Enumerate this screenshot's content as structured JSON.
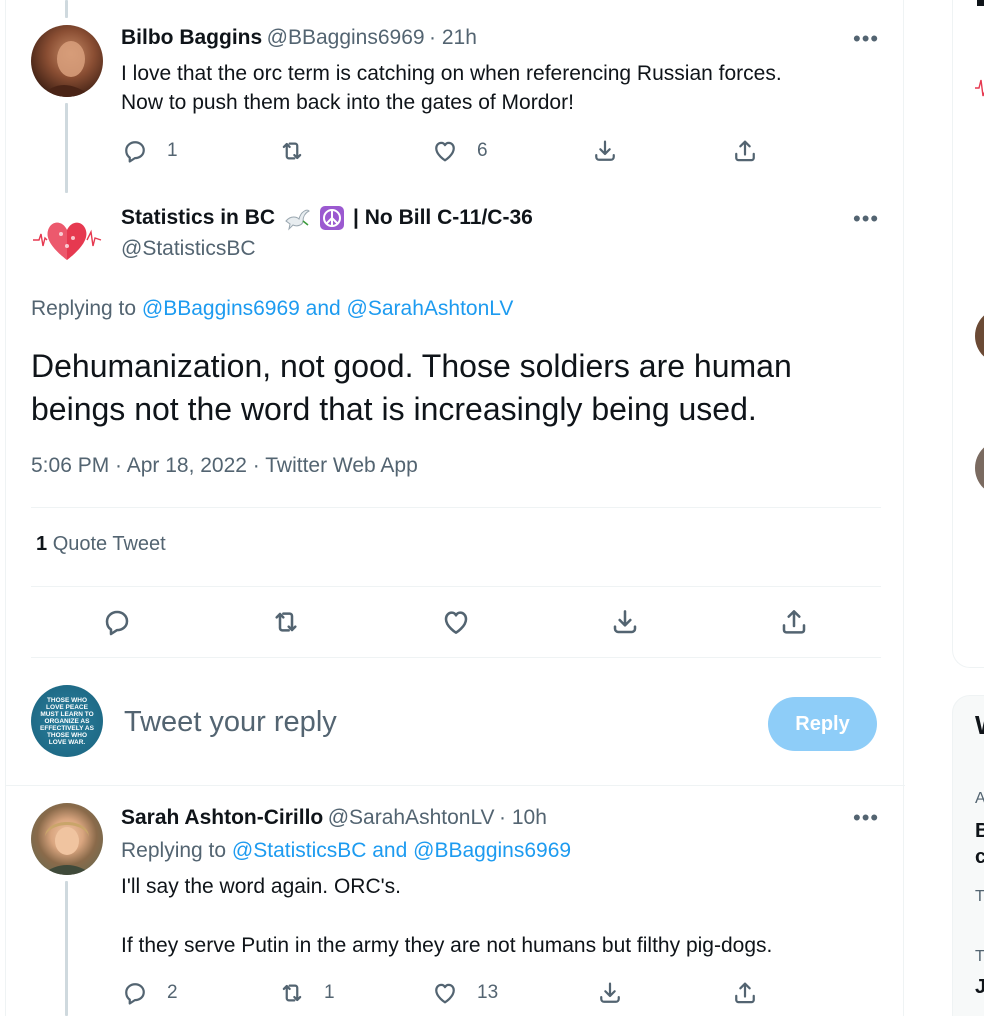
{
  "tweet1": {
    "name": "Bilbo Baggins",
    "handle": "@BBaggins6969",
    "time": "· 21h",
    "text_line1": "I love that the orc term is catching on when referencing Russian forces.",
    "text_line2": "Now to push them back into the gates of Mordor!",
    "reply_count": "1",
    "retweet_count": "",
    "like_count": "6"
  },
  "main_tweet": {
    "name_part1": "Statistics in BC",
    "name_part2": "| No Bill C-11/C-36",
    "handle": "@StatisticsBC",
    "replying_prefix": "Replying to",
    "replying_users": "@BBaggins6969 and @SarahAshtonLV",
    "text_line1": "Dehumanization, not good. Those soldiers are human",
    "text_line2": "beings not the word that is increasingly being used.",
    "meta": "5:06 PM · Apr 18, 2022 · Twitter Web App",
    "quote_count": "1",
    "quote_label": "Quote Tweet"
  },
  "composer": {
    "placeholder": "Tweet your reply",
    "reply_button": "Reply",
    "avatar_text": "THOSE WHO LOVE PEACE MUST LEARN TO ORGANIZE AS EFFECTIVELY AS THOSE WHO LOVE WAR."
  },
  "tweet3": {
    "name": "Sarah Ashton-Cirillo",
    "handle": "@SarahAshtonLV",
    "time": "· 10h",
    "replying_prefix": "Replying to",
    "replying_users": "@StatisticsBC and @BBaggins6969",
    "text_line1": "I'll say the word again. ORC's.",
    "text_line2": "If they serve Putin in the army they are not humans but filthy pig-dogs.",
    "reply_count": "2",
    "retweet_count": "1",
    "like_count": "13"
  },
  "sidebar": {
    "heading_letter": "W",
    "letters": [
      "A",
      "B",
      "c",
      "T",
      "T",
      "J"
    ]
  },
  "colors": {
    "accent": "#1d9bf0",
    "reply_button_disabled": "#8ecdf8",
    "secondary_text": "#536471"
  }
}
